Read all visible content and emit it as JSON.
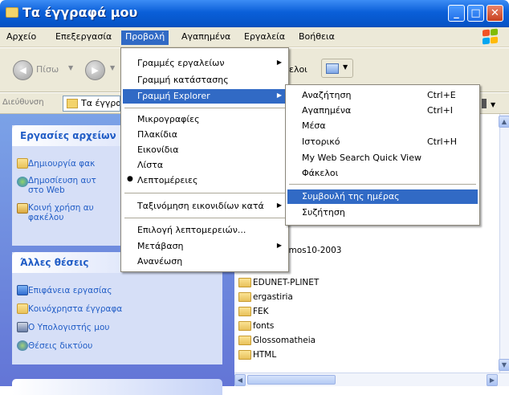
{
  "window": {
    "title": "Τα έγγραφά μου",
    "buttons": {
      "minimize": "_",
      "maximize": "□",
      "close": "✕"
    }
  },
  "menubar": {
    "items": [
      "Αρχείο",
      "Επεξεργασία",
      "Προβολή",
      "Αγαπημένα",
      "Εργαλεία",
      "Βοήθεια"
    ],
    "active": "Προβολή"
  },
  "toolbar": {
    "back_label": "Πίσω",
    "folders_label": "ελοι"
  },
  "address": {
    "label": "Διεύθυνση",
    "value": "Τα έγγραφ"
  },
  "left_pane": {
    "file_tasks": {
      "title": "Εργασίες αρχείων",
      "items": [
        "Δημιουργία φακ",
        "Δημοσίευση αυτ",
        "στο Web",
        "Κοινή χρήση αυ",
        "φακέλου"
      ]
    },
    "other_places": {
      "title": "Άλλες θέσεις",
      "items": [
        "Επιφάνεια εργασίας",
        "Κοινόχρηστα έγγραφα",
        "Ο Υπολογιστής μου",
        "Θέσεις δικτύου"
      ]
    }
  },
  "files": [
    "smos10-2003",
    "EDUNET-PLINET",
    "ergastiria",
    "FEK",
    "fonts",
    "Glossomatheia",
    "HTML"
  ],
  "view_menu": {
    "items": [
      {
        "label": "Γραμμές εργαλείων",
        "submenu": true
      },
      {
        "label": "Γραμμή κατάστασης"
      },
      {
        "label": "Γραμμή Explorer",
        "submenu": true,
        "highlighted": true
      },
      {
        "label": "Μικρογραφίες"
      },
      {
        "label": "Πλακίδια"
      },
      {
        "label": "Εικονίδια"
      },
      {
        "label": "Λίστα"
      },
      {
        "label": "Λεπτομέρειες",
        "checked": true,
        "bullet": "●"
      },
      {
        "label": "Ταξινόμηση εικονιδίων κατά",
        "submenu": true
      },
      {
        "label": "Επιλογή λεπτομερειών..."
      },
      {
        "label": "Μετάβαση",
        "submenu": true
      },
      {
        "label": "Ανανέωση"
      }
    ]
  },
  "explorer_bar_menu": {
    "items": [
      {
        "label": "Αναζήτηση",
        "shortcut": "Ctrl+E"
      },
      {
        "label": "Αγαπημένα",
        "shortcut": "Ctrl+I"
      },
      {
        "label": "Μέσα",
        "shortcut": ""
      },
      {
        "label": "Ιστορικό",
        "shortcut": "Ctrl+H"
      },
      {
        "label": "My Web Search Quick View",
        "shortcut": ""
      },
      {
        "label": "Φάκελοι",
        "shortcut": ""
      },
      {
        "label": "Συμβουλή της ημέρας",
        "shortcut": "",
        "highlighted": true
      },
      {
        "label": "Συζήτηση",
        "shortcut": ""
      }
    ]
  },
  "colors": {
    "title_blue": "#0a5fd8",
    "menu_highlight": "#316ac5",
    "task_link": "#215dc6",
    "pane_blue": "#6f8fe0"
  }
}
